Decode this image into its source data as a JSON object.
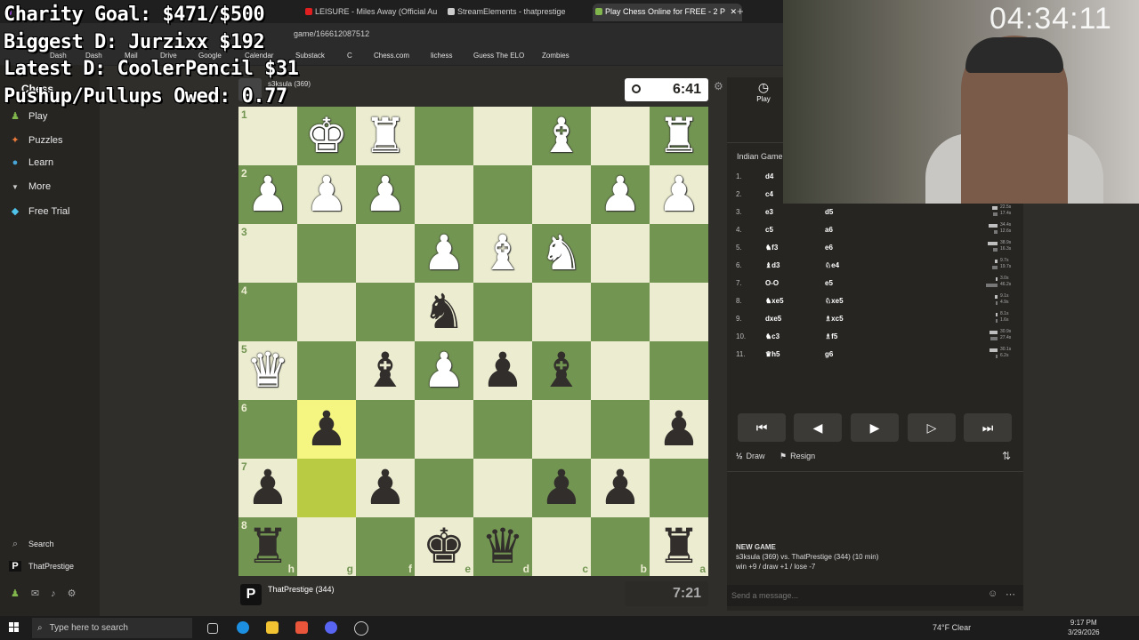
{
  "overlay": {
    "line1": "Charity Goal: $471/$500",
    "line2": "Biggest D: Jurzixx $192",
    "line3": "Latest D: CoolerPencil $31",
    "line4": "Pushup/Pullups Owed: 0.77"
  },
  "browser": {
    "tabs": [
      {
        "label": "",
        "icon_color": "#8a3cc8"
      },
      {
        "label": "LEISURE - Miles Away (Official Au",
        "icon_color": "#e02020"
      },
      {
        "label": "StreamElements - thatprestige",
        "icon_color": "#cccccc"
      },
      {
        "label": "Play Chess Online for FREE - 2 P",
        "icon_color": "#81b64c",
        "close": "✕"
      }
    ],
    "new_tab": "+",
    "url": "game/166612087512",
    "bookmarks": [
      "Dash",
      "Dash",
      "Mail",
      "Drive",
      "Google",
      "Calendar",
      "Substack",
      "C",
      "Chess.com",
      "lichess",
      "Guess The ELO",
      "Zombies"
    ]
  },
  "sidebar": {
    "logo": "Chess",
    "items": [
      {
        "label": "Play",
        "icon": "play-pawn-icon",
        "color": "#81b64c"
      },
      {
        "label": "Puzzles",
        "icon": "puzzle-icon",
        "color": "#e8793a"
      },
      {
        "label": "Learn",
        "icon": "graduation-icon",
        "color": "#48a5d8"
      },
      {
        "label": "More",
        "icon": "chevron-down-icon",
        "color": "#cccccc"
      },
      {
        "label": "Free Trial",
        "icon": "diamond-icon",
        "color": "#4fc3e8"
      }
    ],
    "search_label": "Search",
    "profile_label": "ThatPrestige",
    "profile_initial": "P"
  },
  "opponent": {
    "name": "s3ksula (369)",
    "clock": "6:41"
  },
  "me": {
    "name": "ThatPrestige (344)",
    "avatar_letter": "P",
    "clock": "7:21"
  },
  "board": {
    "ranks": [
      "1",
      "2",
      "3",
      "4",
      "5",
      "6",
      "7",
      "8"
    ],
    "files": [
      "h",
      "g",
      "f",
      "e",
      "d",
      "c",
      "b",
      "a"
    ],
    "highlight": [
      [
        5,
        1
      ],
      [
        6,
        1
      ]
    ],
    "pieces": [
      {
        "r": 0,
        "c": 1,
        "p": "♚",
        "color": "w"
      },
      {
        "r": 0,
        "c": 2,
        "p": "♜",
        "color": "w"
      },
      {
        "r": 0,
        "c": 5,
        "p": "♝",
        "color": "w"
      },
      {
        "r": 0,
        "c": 7,
        "p": "♜",
        "color": "w"
      },
      {
        "r": 1,
        "c": 0,
        "p": "♟",
        "color": "w"
      },
      {
        "r": 1,
        "c": 1,
        "p": "♟",
        "color": "w"
      },
      {
        "r": 1,
        "c": 2,
        "p": "♟",
        "color": "w"
      },
      {
        "r": 1,
        "c": 6,
        "p": "♟",
        "color": "w"
      },
      {
        "r": 1,
        "c": 7,
        "p": "♟",
        "color": "w"
      },
      {
        "r": 2,
        "c": 3,
        "p": "♟",
        "color": "w"
      },
      {
        "r": 2,
        "c": 4,
        "p": "♝",
        "color": "w"
      },
      {
        "r": 2,
        "c": 5,
        "p": "♞",
        "color": "w"
      },
      {
        "r": 3,
        "c": 3,
        "p": "♞",
        "color": "b"
      },
      {
        "r": 4,
        "c": 0,
        "p": "♛",
        "color": "w"
      },
      {
        "r": 4,
        "c": 2,
        "p": "♝",
        "color": "b"
      },
      {
        "r": 4,
        "c": 3,
        "p": "♟",
        "color": "w"
      },
      {
        "r": 4,
        "c": 4,
        "p": "♟",
        "color": "b"
      },
      {
        "r": 4,
        "c": 5,
        "p": "♝",
        "color": "b"
      },
      {
        "r": 5,
        "c": 1,
        "p": "♟",
        "color": "b"
      },
      {
        "r": 5,
        "c": 7,
        "p": "♟",
        "color": "b"
      },
      {
        "r": 6,
        "c": 0,
        "p": "♟",
        "color": "b"
      },
      {
        "r": 6,
        "c": 2,
        "p": "♟",
        "color": "b"
      },
      {
        "r": 6,
        "c": 5,
        "p": "♟",
        "color": "b"
      },
      {
        "r": 6,
        "c": 6,
        "p": "♟",
        "color": "b"
      },
      {
        "r": 7,
        "c": 0,
        "p": "♜",
        "color": "b"
      },
      {
        "r": 7,
        "c": 3,
        "p": "♚",
        "color": "b"
      },
      {
        "r": 7,
        "c": 4,
        "p": "♛",
        "color": "b"
      },
      {
        "r": 7,
        "c": 7,
        "p": "♜",
        "color": "b"
      }
    ]
  },
  "panel": {
    "play_tab": "Play",
    "opening": "Indian Game:",
    "moves": [
      {
        "n": "1.",
        "w": "d4",
        "b": ""
      },
      {
        "n": "2.",
        "w": "c4",
        "b": ""
      },
      {
        "n": "3.",
        "w": "e3",
        "b": "d5",
        "t1": "22.5s",
        "t2": "17.4s"
      },
      {
        "n": "4.",
        "w": "c5",
        "b": "a6",
        "t1": "34.4s",
        "t2": "12.6s"
      },
      {
        "n": "5.",
        "w": "♞f3",
        "b": "e6",
        "t1": "38.9s",
        "t2": "16.3s"
      },
      {
        "n": "6.",
        "w": "♝d3",
        "b": "♘e4",
        "t1": "9.7s",
        "t2": "19.7s"
      },
      {
        "n": "7.",
        "w": "O-O",
        "b": "e5",
        "t1": "3.0s",
        "t2": "46.2s"
      },
      {
        "n": "8.",
        "w": "♞xe5",
        "b": "♘xe5",
        "t1": "9.1s",
        "t2": "4.9s"
      },
      {
        "n": "9.",
        "w": "dxe5",
        "b": "♗xc5",
        "t1": "8.1s",
        "t2": "1.6s"
      },
      {
        "n": "10.",
        "w": "♞c3",
        "b": "♗f5",
        "t1": "30.9s",
        "t2": "27.4s"
      },
      {
        "n": "11.",
        "w": "♛h5",
        "b": "g6",
        "t1": "30.1s",
        "t2": "6.2s"
      }
    ],
    "nav": [
      "⏮",
      "◀",
      "▶",
      "▷",
      "⏭"
    ],
    "draw": "Draw",
    "draw_prefix": "½",
    "resign": "Resign",
    "new_game_title": "NEW GAME",
    "new_game_line1": "s3ksula (369) vs. ThatPrestige (344) (10 min)",
    "new_game_line2": "win +9 / draw +1 / lose -7",
    "message_placeholder": "Send a message..."
  },
  "stream": {
    "cam_clock": "04:34:11"
  },
  "taskbar": {
    "search": "Type here to search",
    "weather": "74°F  Clear",
    "time": "9:17 PM",
    "date": "3/29/2026"
  }
}
